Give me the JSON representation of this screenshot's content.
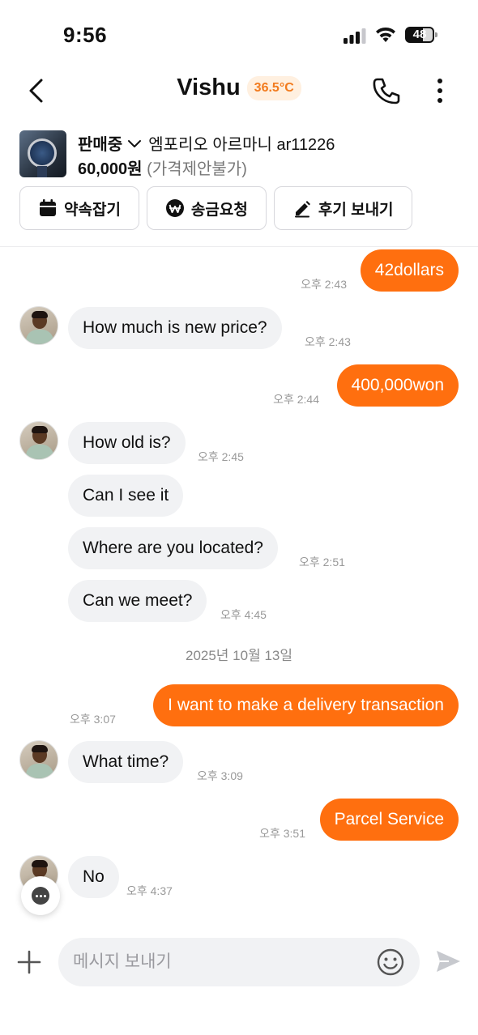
{
  "status": {
    "time": "9:56",
    "battery": "48"
  },
  "header": {
    "title": "Vishu",
    "temperature": "36.5°C"
  },
  "product": {
    "status_label": "판매중",
    "name": "엠포리오 아르마니 ar11226",
    "price": "60,000원",
    "negotiation": "(가격제안불가)"
  },
  "actions": {
    "appointment": "약속잡기",
    "remit": "송금요청",
    "review": "후기 보내기"
  },
  "messages": [
    {
      "text": "42dollars",
      "time": "오후 2:43"
    },
    {
      "text": "How much is new price?",
      "time": "오후 2:43"
    },
    {
      "text": "400,000won",
      "time": "오후 2:44"
    },
    {
      "text": "How old is?",
      "time": "오후 2:45"
    },
    {
      "text": "Can I see it",
      "time": ""
    },
    {
      "text": "Where are you located?",
      "time": "오후 2:51"
    },
    {
      "text": "Can we meet?",
      "time": "오후 4:45"
    },
    {
      "text": "I want to make a delivery transaction",
      "time": "오후 3:07"
    },
    {
      "text": "What time?",
      "time": "오후 3:09"
    },
    {
      "text": "Parcel Service",
      "time": "오후 3:51"
    },
    {
      "text": "No",
      "time": "오후 4:37"
    }
  ],
  "date_separator": "2025년 10월 13일",
  "input": {
    "placeholder": "메시지 보내기"
  },
  "colors": {
    "accent": "#ff6f0f",
    "incoming_bubble": "#f1f2f4",
    "temperature_text": "#f27b1e"
  }
}
